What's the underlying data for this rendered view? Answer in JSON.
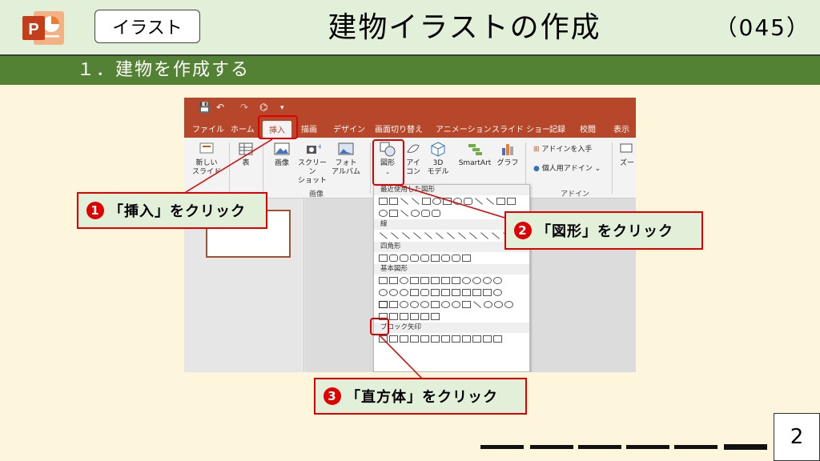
{
  "header": {
    "category": "イラスト",
    "title": "建物イラストの作成",
    "code": "（045）"
  },
  "section": {
    "heading": "１．建物を作成する"
  },
  "ribbon": {
    "tabs": [
      "ファイル",
      "ホーム",
      "挿入",
      "描画",
      "デザイン",
      "画面切り替え",
      "アニメーション",
      "スライド ショー",
      "記録",
      "校閲",
      "表示"
    ],
    "buttons": {
      "new_slide": "新しい\nスライド",
      "table": "表",
      "image": "画像",
      "screenshot": "スクリーン\nショット",
      "photo_album": "フォト\nアルバム",
      "shapes": "図形",
      "icons": "アイ\nコン",
      "model3d": "3D\nモデル",
      "smartart": "SmartArt",
      "chart": "グラフ",
      "get_addins": "アドインを入手",
      "my_addins": "個人用アドイン",
      "zoom": "ズー"
    },
    "group_labels": {
      "image": "画像",
      "addins": "アドイン"
    }
  },
  "shape_menu": {
    "recent": "最近使用した図形",
    "lines": "線",
    "rectangles": "四角形",
    "basic": "基本図形",
    "block_arrows": "ブロック矢印"
  },
  "callouts": [
    {
      "num": "1",
      "text": "「挿入」をクリック"
    },
    {
      "num": "2",
      "text": "「図形」をクリック"
    },
    {
      "num": "3",
      "text": "「直方体」をクリック"
    }
  ],
  "page_number": "2",
  "colors": {
    "accent_red": "#e00000",
    "header_bg": "#e2efd9",
    "section_bar": "#548235",
    "ppt_orange": "#b7472a"
  }
}
